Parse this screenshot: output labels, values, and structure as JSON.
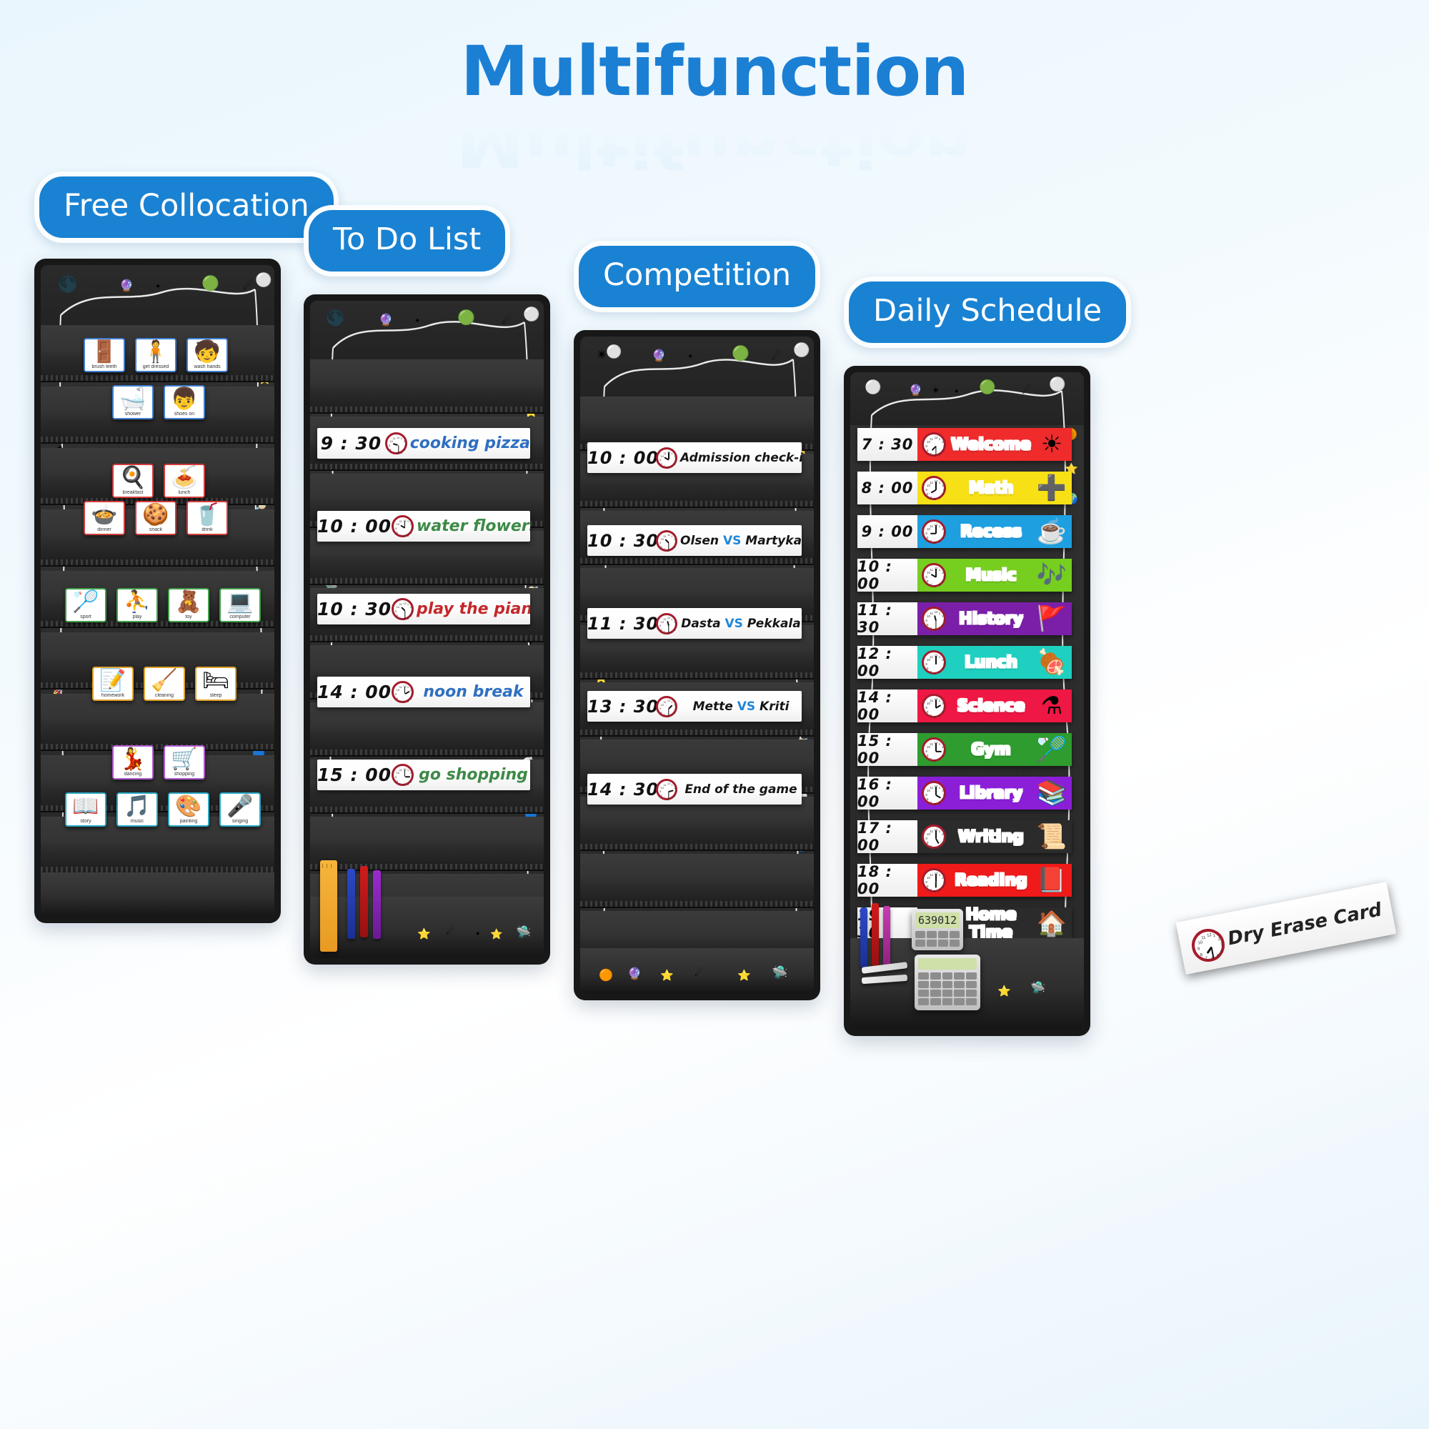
{
  "title": "Multifunction",
  "sections": [
    {
      "badge": "Free Collocation"
    },
    {
      "badge": "To Do List"
    },
    {
      "badge": "Competition"
    },
    {
      "badge": "Daily Schedule"
    }
  ],
  "free_collocation": {
    "badge": "Free Collocation",
    "cards": [
      {
        "caption": "brush teeth",
        "icon": "🚪",
        "accent": "#3f7fd0",
        "row": 0,
        "col": 0
      },
      {
        "caption": "get dressed",
        "icon": "🧍",
        "accent": "#3f7fd0",
        "row": 0,
        "col": 1
      },
      {
        "caption": "wash hands",
        "icon": "🧒",
        "accent": "#3f7fd0",
        "row": 0,
        "col": 2
      },
      {
        "caption": "shower",
        "icon": "🛁",
        "accent": "#3f7fd0",
        "row": 1,
        "col": 0
      },
      {
        "caption": "shoes on",
        "icon": "👦",
        "accent": "#3f7fd0",
        "row": 1,
        "col": 1
      },
      {
        "caption": "breakfast",
        "icon": "🍳",
        "accent": "#d23c3c",
        "row": 2,
        "col": 0
      },
      {
        "caption": "lunch",
        "icon": "🍝",
        "accent": "#d23c3c",
        "row": 2,
        "col": 1
      },
      {
        "caption": "dinner",
        "icon": "🍲",
        "accent": "#d23c3c",
        "row": 3,
        "col": 0
      },
      {
        "caption": "snack",
        "icon": "🍪",
        "accent": "#d23c3c",
        "row": 3,
        "col": 1
      },
      {
        "caption": "drink",
        "icon": "🥤",
        "accent": "#d23c3c",
        "row": 3,
        "col": 2
      },
      {
        "caption": "sport",
        "icon": "🏸",
        "accent": "#3fa04a",
        "row": 4,
        "col": 0
      },
      {
        "caption": "play",
        "icon": "⛹",
        "accent": "#3fa04a",
        "row": 4,
        "col": 1
      },
      {
        "caption": "toy",
        "icon": "🧸",
        "accent": "#3fa04a",
        "row": 4,
        "col": 2
      },
      {
        "caption": "computer",
        "icon": "💻",
        "accent": "#3fa04a",
        "row": 4,
        "col": 3
      },
      {
        "caption": "homework",
        "icon": "📝",
        "accent": "#e0a32a",
        "row": 5,
        "col": 0
      },
      {
        "caption": "cleaning",
        "icon": "🧹",
        "accent": "#e0a32a",
        "row": 5,
        "col": 1
      },
      {
        "caption": "sleep",
        "icon": "🛏",
        "accent": "#e0a32a",
        "row": 5,
        "col": 2
      },
      {
        "caption": "dancing",
        "icon": "💃",
        "accent": "#b15ad0",
        "row": 6,
        "col": 0
      },
      {
        "caption": "shopping",
        "icon": "🛒",
        "accent": "#b15ad0",
        "row": 6,
        "col": 1
      },
      {
        "caption": "story",
        "icon": "📖",
        "accent": "#2aa7c4",
        "row": 7,
        "col": 0
      },
      {
        "caption": "music",
        "icon": "🎵",
        "accent": "#2aa7c4",
        "row": 7,
        "col": 1
      },
      {
        "caption": "painting",
        "icon": "🎨",
        "accent": "#2aa7c4",
        "row": 7,
        "col": 2
      },
      {
        "caption": "singing",
        "icon": "🎤",
        "accent": "#2aa7c4",
        "row": 7,
        "col": 3
      }
    ]
  },
  "todo_list": {
    "badge": "To Do List",
    "rows": [
      {
        "time": "9 : 30",
        "task": "cooking pizza",
        "color": "#2f6fc0",
        "hour": 9,
        "minute": 30
      },
      {
        "time": "10 : 00",
        "task": "water flowers",
        "color": "#3d8a46",
        "hour": 10,
        "minute": 0
      },
      {
        "time": "10 : 30",
        "task": "play the piano",
        "color": "#c4282b",
        "hour": 10,
        "minute": 30
      },
      {
        "time": "14 : 00",
        "task": "noon break",
        "color": "#2f6fc0",
        "hour": 2,
        "minute": 0
      },
      {
        "time": "15 : 00",
        "task": "go shopping",
        "color": "#3d8a46",
        "hour": 3,
        "minute": 0
      }
    ]
  },
  "competition": {
    "badge": "Competition",
    "rows": [
      {
        "time": "10 : 00",
        "task": "Admission check-in",
        "vs": false,
        "left": "Admission check-in",
        "right": "",
        "hour": 10,
        "minute": 0
      },
      {
        "time": "10 : 30",
        "task": "Olsen VS Martyka",
        "vs": true,
        "left": "Olsen",
        "right": "Martyka",
        "hour": 10,
        "minute": 30
      },
      {
        "time": "11 : 30",
        "task": "Dasta VS Pekkala",
        "vs": true,
        "left": "Dasta",
        "right": "Pekkala",
        "hour": 11,
        "minute": 30
      },
      {
        "time": "13 : 30",
        "task": "Mette VS Kriti",
        "vs": true,
        "left": "Mette",
        "right": "Kriti",
        "hour": 1,
        "minute": 30
      },
      {
        "time": "14 : 30",
        "task": "End of the game",
        "vs": false,
        "left": "End of the game",
        "right": "",
        "hour": 2,
        "minute": 30
      }
    ],
    "vs_label": "VS"
  },
  "daily_schedule": {
    "badge": "Daily Schedule",
    "rows": [
      {
        "time": "7 : 30",
        "subject": "Welcome",
        "color": "#ef2b2b",
        "icon": "☀",
        "hour": 7,
        "minute": 30
      },
      {
        "time": "8 : 00",
        "subject": "Math",
        "color": "#f7e016",
        "icon": "➕",
        "hour": 8,
        "minute": 0
      },
      {
        "time": "9 : 00",
        "subject": "Recess",
        "color": "#1e9fe0",
        "icon": "☕",
        "hour": 9,
        "minute": 0
      },
      {
        "time": "10 : 00",
        "subject": "Music",
        "color": "#76ce1f",
        "icon": "🎶",
        "hour": 10,
        "minute": 0
      },
      {
        "time": "11 : 30",
        "subject": "History",
        "color": "#7b1fa8",
        "icon": "🚩",
        "hour": 11,
        "minute": 30
      },
      {
        "time": "12 : 00",
        "subject": "Lunch",
        "color": "#1fd0c0",
        "icon": "🍖",
        "hour": 12,
        "minute": 0
      },
      {
        "time": "14 : 00",
        "subject": "Science",
        "color": "#ef1743",
        "icon": "⚗",
        "hour": 2,
        "minute": 0
      },
      {
        "time": "15 : 00",
        "subject": "Gym",
        "color": "#2e9c2e",
        "icon": "🏸",
        "hour": 3,
        "minute": 0
      },
      {
        "time": "16 : 00",
        "subject": "Library",
        "color": "#8b1fd8",
        "icon": "📚",
        "hour": 4,
        "minute": 0
      },
      {
        "time": "17 : 00",
        "subject": "Writing",
        "color": "#2b2b2b",
        "icon": "📜",
        "hour": 5,
        "minute": 0
      },
      {
        "time": "18 : 00",
        "subject": "Reading",
        "color": "#ef1a1a",
        "icon": "📕",
        "hour": 6,
        "minute": 0
      },
      {
        "time": "19 : 30",
        "subject": "Home Time",
        "color": "#2b2b2b",
        "icon": "🏠",
        "hour": 7,
        "minute": 30
      }
    ],
    "dry_erase_card": "Dry Erase Card",
    "calculator_display": "639012"
  },
  "colors": {
    "accent_blue": "#1a82d2",
    "title_blue": "#1b7fd4",
    "board_dark": "#181818",
    "clock_ring": "#a51c2c",
    "vs_blue": "#1f86d8"
  }
}
